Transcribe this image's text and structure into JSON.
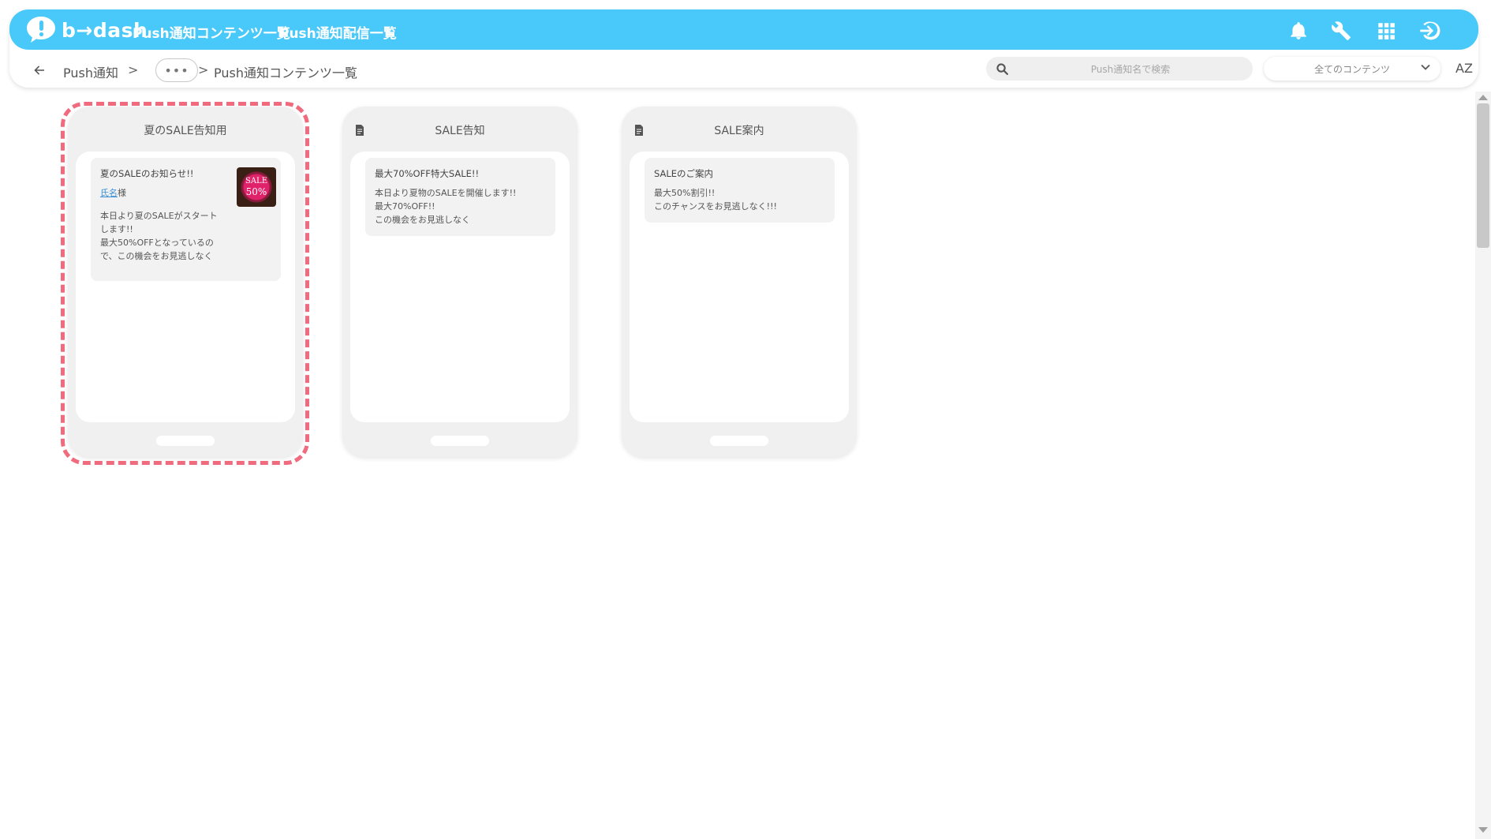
{
  "header": {
    "logo_text": "b→dash",
    "nav": [
      "Push通知コンテンツ一覧",
      "Push通知配信一覧"
    ],
    "icons": [
      "bell-icon",
      "wrench-icon",
      "grid-icon",
      "logout-icon"
    ]
  },
  "breadcrumb": {
    "root": "Push通知",
    "sep": ">",
    "more": "•••",
    "current": "Push通知コンテンツ一覧"
  },
  "search": {
    "placeholder": "Push通知名で検索"
  },
  "filter": {
    "selected": "全てのコンテンツ"
  },
  "sort": {
    "label": "AZ"
  },
  "cards": [
    {
      "title": "夏のSALE告知用",
      "notif_title": "夏のSALEのお知らせ!!",
      "name_link": "氏名",
      "name_suffix": "様",
      "body": "本日より夏のSALEがスタート\nします!!\n最大50%OFFとなっているの\nで、この機会をお見逃しなく",
      "thumb_line1": "SALE",
      "thumb_line2": "50%",
      "icon": "document-icon"
    },
    {
      "title": "SALE告知",
      "notif_title": "最大70%OFF特大SALE!!",
      "body": "本日より夏物のSALEを開催します!!\n最大70%OFF!!\nこの機会をお見逃しなく",
      "icon": "document-icon"
    },
    {
      "title": "SALE案内",
      "notif_title": "SALEのご案内",
      "body": "最大50%割引!!\nこのチャンスをお見逃しなく!!!",
      "icon": "document-icon"
    }
  ],
  "colors": {
    "primary": "#49c9f9",
    "selected_outline": "#f06b7e",
    "link": "#3a8fd6"
  }
}
